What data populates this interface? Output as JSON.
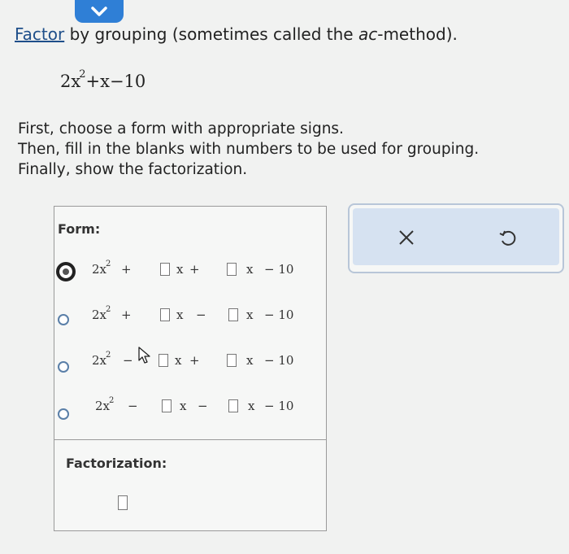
{
  "header": {
    "title_link": "Factor",
    "title_rest_before": " by grouping (sometimes called the ",
    "title_em": "ac",
    "title_rest_after": "-method)."
  },
  "problem": {
    "coef": "2x",
    "exponent": "2",
    "rest": "+x−10"
  },
  "instructions": [
    "First, choose a form with appropriate signs.",
    "Then, fill in the blanks with numbers to be used for grouping.",
    "Finally, show the factorization."
  ],
  "form": {
    "label": "Form:",
    "options": [
      {
        "lead": "2x",
        "exp": "2",
        "op1": "+",
        "op2": "+",
        "x1": "x",
        "x2": "x",
        "tail": "− 10",
        "selected": true
      },
      {
        "lead": "2x",
        "exp": "2",
        "op1": "+",
        "op2": "−",
        "x1": "x",
        "x2": "x",
        "tail": "− 10",
        "selected": false
      },
      {
        "lead": "2x",
        "exp": "2",
        "op1": "−",
        "op2": "+",
        "x1": "x",
        "x2": "x",
        "tail": "− 10",
        "selected": false
      },
      {
        "lead": "2x",
        "exp": "2",
        "op1": "−",
        "op2": "−",
        "x1": "x",
        "x2": "x",
        "tail": "− 10",
        "selected": false
      }
    ]
  },
  "factorization": {
    "label": "Factorization:"
  },
  "actions": {
    "clear_icon": "close-icon",
    "undo_icon": "undo-icon"
  },
  "colors": {
    "accent": "#2f7fd6",
    "action_bg": "#d6e2f1",
    "link": "#1f4f8a"
  }
}
